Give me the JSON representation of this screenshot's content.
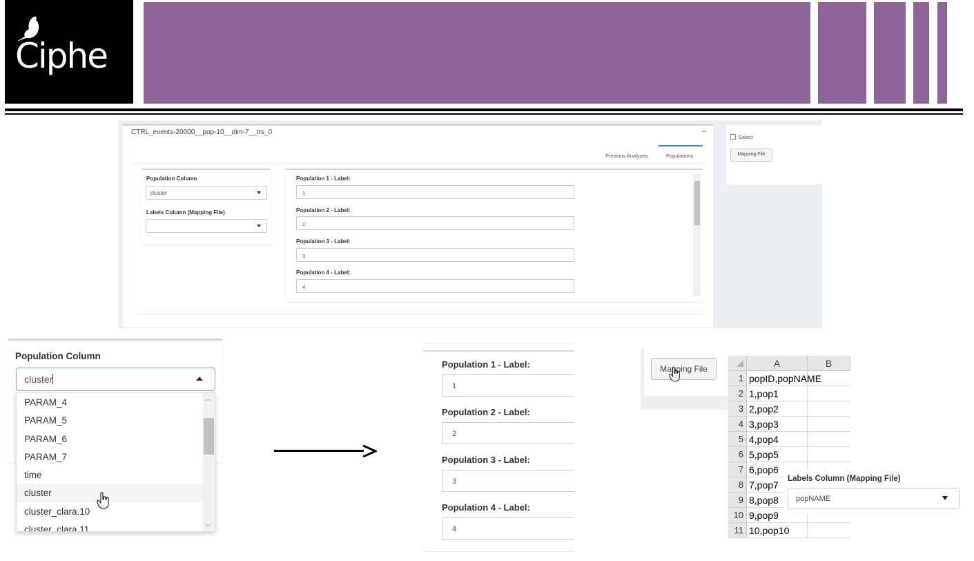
{
  "header": {
    "logo_text": "Ciphe",
    "colors": {
      "purple": "#8f6599",
      "black": "#000000"
    }
  },
  "app": {
    "dataset_title": "CTRL_events-20000__pop-10__dim-7__trs_0",
    "collapse_label": "–",
    "tabs": [
      {
        "label": "Previous Analyses"
      },
      {
        "label": "Populations",
        "active": true
      }
    ],
    "population_column": {
      "label": "Population Column",
      "value": "cluster"
    },
    "labels_column": {
      "label": "Labels Column (Mapping File)",
      "value": ""
    },
    "populations": [
      {
        "label": "Population 1 - Label:",
        "value": "1"
      },
      {
        "label": "Population 2 - Label:",
        "value": "2"
      },
      {
        "label": "Population 3 - Label:",
        "value": "3"
      },
      {
        "label": "Population 4 - Label:",
        "value": "4"
      }
    ],
    "select_checkbox_label": "Select",
    "mapping_button_label": "Mapping File"
  },
  "dropdown_zoom": {
    "label": "Population Column",
    "input_value": "cluster",
    "options": [
      "PARAM_4",
      "PARAM_5",
      "PARAM_6",
      "PARAM_7",
      "time",
      "cluster",
      "cluster_clara.10",
      "cluster_clara.11"
    ],
    "active_option": "cluster"
  },
  "population_zoom": [
    {
      "label": "Population 1 - Label:",
      "value": "1"
    },
    {
      "label": "Population 2 - Label:",
      "value": "2"
    },
    {
      "label": "Population 3 - Label:",
      "value": "3"
    },
    {
      "label": "Population 4 - Label:",
      "value": "4"
    }
  ],
  "mapping_zoom": {
    "button_label": "Mapping File"
  },
  "spreadsheet": {
    "columns": [
      "A",
      "B"
    ],
    "rows": [
      {
        "num": "1",
        "a": "popID,popNAME"
      },
      {
        "num": "2",
        "a": "1,pop1"
      },
      {
        "num": "3",
        "a": "2,pop2"
      },
      {
        "num": "4",
        "a": "3,pop3"
      },
      {
        "num": "5",
        "a": "4,pop4"
      },
      {
        "num": "6",
        "a": "5,pop5"
      },
      {
        "num": "7",
        "a": "6,pop6"
      },
      {
        "num": "8",
        "a": "7,pop7"
      },
      {
        "num": "9",
        "a": "8,pop8"
      },
      {
        "num": "10",
        "a": "9,pop9"
      },
      {
        "num": "11",
        "a": "10,pop10"
      }
    ]
  },
  "labels_column_zoom": {
    "label": "Labels Column (Mapping File)",
    "value": "popNAME"
  }
}
